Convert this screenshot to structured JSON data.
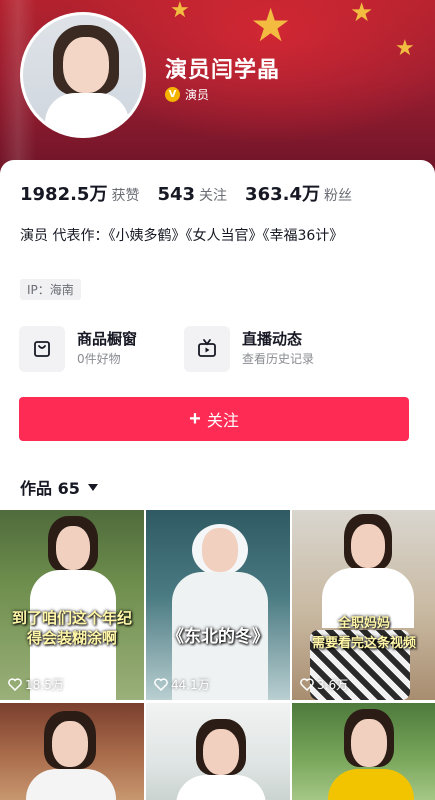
{
  "profile": {
    "name": "演员闫学晶",
    "verify_badge": "V",
    "verify_label": "演员"
  },
  "stats": [
    {
      "value": "1982.5万",
      "label": "获赞"
    },
    {
      "value": "543",
      "label": "关注"
    },
    {
      "value": "363.4万",
      "label": "粉丝"
    }
  ],
  "bio": "演员 代表作：《小姨多鹤》《女人当官》《幸福36计》",
  "ip": "IP：海南",
  "entries": [
    {
      "title": "商品橱窗",
      "subtitle": "0件好物",
      "icon": "shopping-bag-icon"
    },
    {
      "title": "直播动态",
      "subtitle": "查看历史记录",
      "icon": "tv-icon"
    }
  ],
  "follow_button": {
    "label": "关注"
  },
  "works_tab": {
    "label": "作品 65"
  },
  "videos": [
    {
      "caption": "到了咱们这个年纪\n得会装糊涂啊",
      "likes": "18.5万"
    },
    {
      "caption": "《东北的冬》",
      "likes": "44.1万"
    },
    {
      "caption": "全职妈妈\n需要看完这条视频",
      "likes": "3.6万"
    },
    {
      "caption": "",
      "likes": ""
    },
    {
      "caption": "",
      "likes": ""
    },
    {
      "caption": "",
      "likes": ""
    }
  ],
  "colors": {
    "accent": "#fe2c55",
    "banner": "#9a1e30",
    "star": "#f5c542"
  }
}
